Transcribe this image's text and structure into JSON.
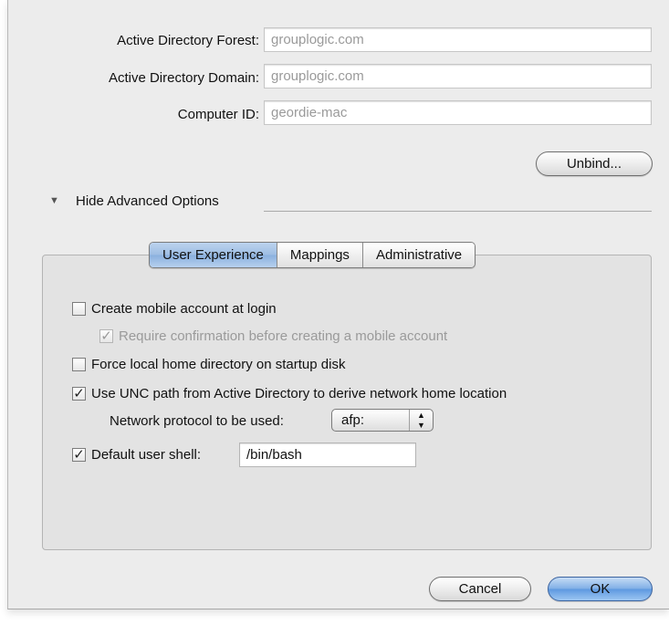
{
  "ad": {
    "forest_label": "Active Directory Forest:",
    "forest_value": "grouplogic.com",
    "domain_label": "Active Directory Domain:",
    "domain_value": "grouplogic.com",
    "computer_id_label": "Computer ID:",
    "computer_id_value": "geordie-mac",
    "unbind_label": "Unbind..."
  },
  "advanced": {
    "toggle_label": "Hide Advanced Options",
    "tabs": [
      "User Experience",
      "Mappings",
      "Administrative"
    ],
    "selected_tab": "User Experience"
  },
  "user_experience": {
    "mobile_account": {
      "label": "Create mobile account at login",
      "checked": false
    },
    "require_confirmation": {
      "label": "Require confirmation before creating a mobile account",
      "checked": true,
      "enabled": false
    },
    "force_local_home": {
      "label": "Force local home directory on startup disk",
      "checked": false
    },
    "use_unc": {
      "label": "Use UNC path from Active Directory to derive network home location",
      "checked": true
    },
    "protocol_label": "Network protocol to be used:",
    "protocol_value": "afp:",
    "default_shell": {
      "label": "Default user shell:",
      "checked": true,
      "value": "/bin/bash"
    }
  },
  "footer": {
    "cancel_label": "Cancel",
    "ok_label": "OK"
  }
}
